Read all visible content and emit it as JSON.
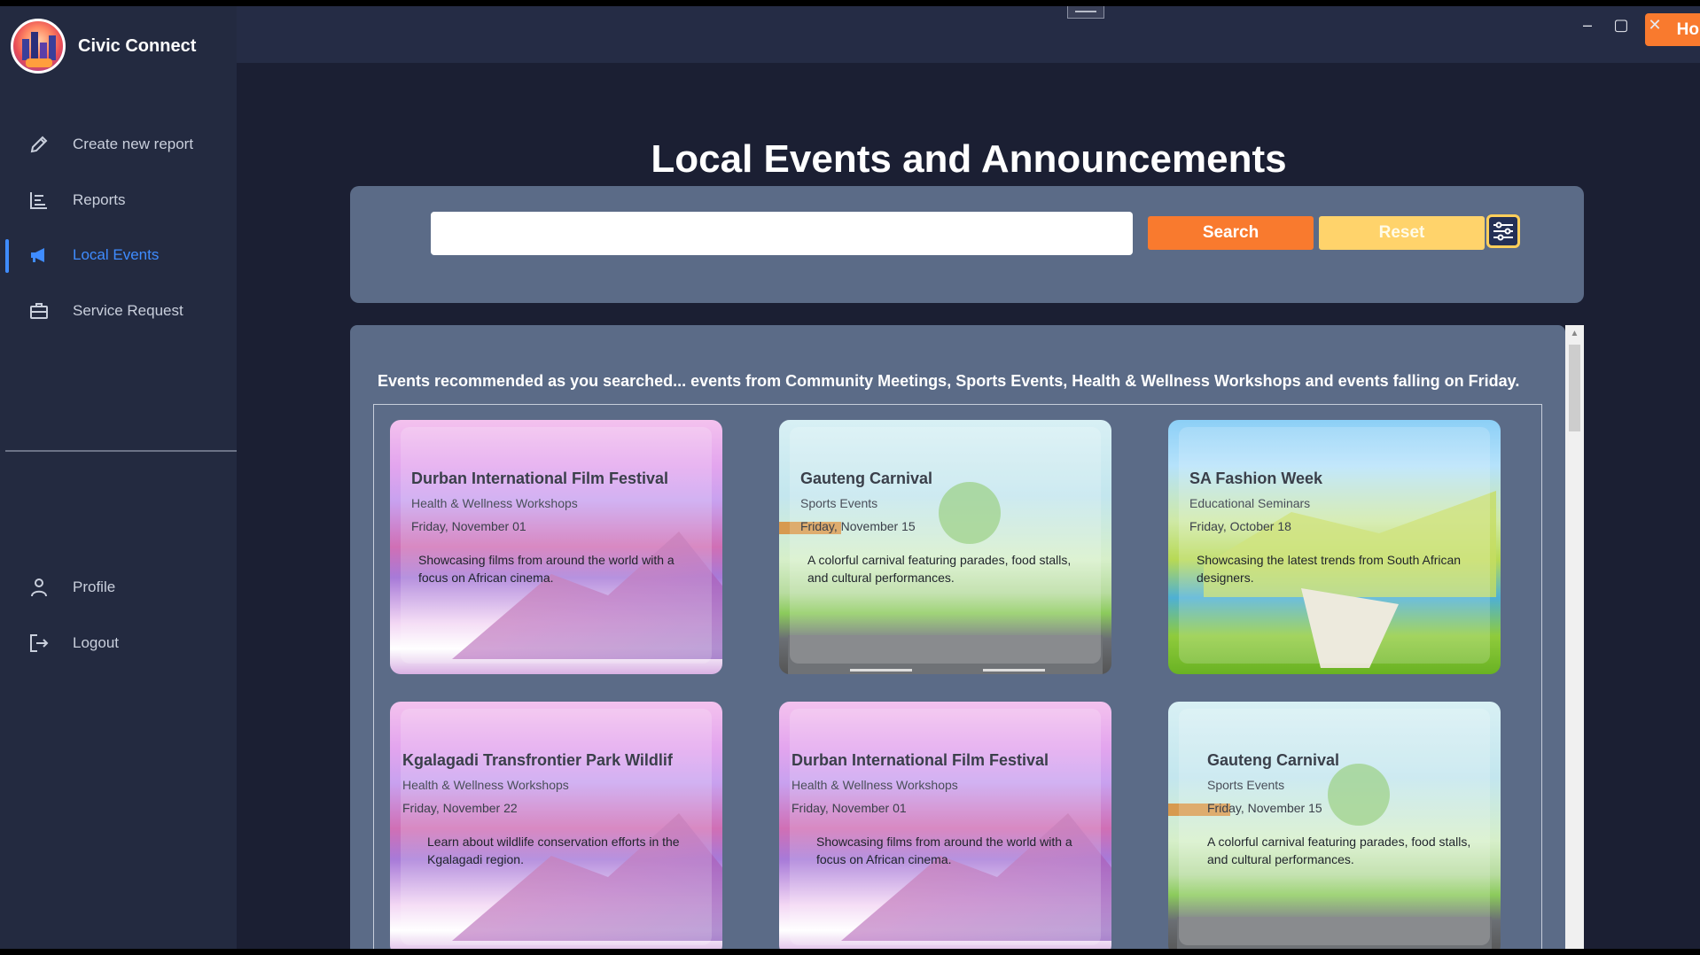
{
  "app": {
    "name": "Civic Connect"
  },
  "sidebar": {
    "items": [
      {
        "label": "Create new report",
        "icon": "pencil-icon"
      },
      {
        "label": "Reports",
        "icon": "list-icon"
      },
      {
        "label": "Local Events",
        "icon": "megaphone-icon",
        "active": true
      },
      {
        "label": "Service Request",
        "icon": "briefcase-icon"
      }
    ],
    "bottom_items": [
      {
        "label": "Profile",
        "icon": "user-icon"
      },
      {
        "label": "Logout",
        "icon": "logout-icon"
      }
    ]
  },
  "topbar": {
    "home_label": "Home",
    "window_controls": {
      "minimize": "–",
      "maximize": "▢",
      "close": "✕"
    }
  },
  "main": {
    "title": "Local Events and Announcements",
    "search": {
      "value": "",
      "placeholder": "",
      "search_label": "Search",
      "reset_label": "Reset"
    },
    "recommendation": "Events recommended as you searched... events from Community Meetings, Sports Events, Health & Wellness Workshops and events falling on Friday.",
    "events": [
      {
        "title": "Durban International Film Festival",
        "category": "Health & Wellness Workshops",
        "date": "Friday, November 01",
        "description": "Showcasing films from around the world with a focus on African cinema."
      },
      {
        "title": "Gauteng Carnival",
        "category": "Sports Events",
        "date": "Friday, November 15",
        "description": "A colorful carnival featuring parades, food stalls, and cultural performances."
      },
      {
        "title": "SA Fashion Week",
        "category": "Educational Seminars",
        "date": "Friday, October 18",
        "description": "Showcasing the latest trends from South African designers."
      },
      {
        "title": "Kgalagadi Transfrontier Park Wildlif",
        "category": "Health & Wellness Workshops",
        "date": "Friday, November 22",
        "description": "Learn about wildlife conservation efforts in the Kgalagadi region."
      },
      {
        "title": "Durban International Film Festival",
        "category": "Health & Wellness Workshops",
        "date": "Friday, November 01",
        "description": "Showcasing films from around the world with a focus on African cinema."
      },
      {
        "title": "Gauteng Carnival",
        "category": "Sports Events",
        "date": "Friday, November 15",
        "description": "A colorful carnival featuring parades, food stalls, and cultural performances."
      }
    ]
  },
  "colors": {
    "accent": "#f97a2e",
    "reset": "#ffd36b",
    "active_nav": "#3f8cff",
    "panel": "#5b6b87",
    "sidebar": "#232a40",
    "background": "#1b1f33"
  }
}
